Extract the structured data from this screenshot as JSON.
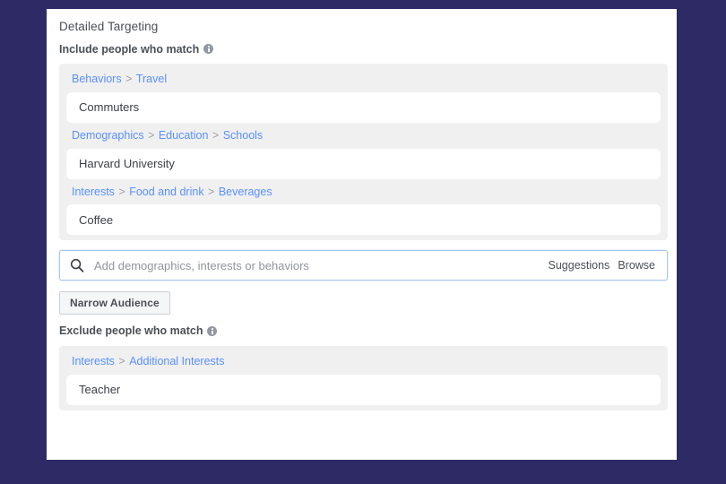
{
  "theme": {
    "background": "#2d2a66",
    "card": "#ffffff",
    "group_bg": "#f0f0f0",
    "link_blue": "#5890ff",
    "focus_border": "#a8c7f0",
    "text": "#4b4f56"
  },
  "panel": {
    "title": "Detailed Targeting",
    "include_label": "Include people who match",
    "exclude_label": "Exclude people who match",
    "info_icon": "info-icon"
  },
  "include_group": {
    "entries": [
      {
        "breadcrumb": [
          "Behaviors",
          "Travel"
        ],
        "item": "Commuters"
      },
      {
        "breadcrumb": [
          "Demographics",
          "Education",
          "Schools"
        ],
        "item": "Harvard University"
      },
      {
        "breadcrumb": [
          "Interests",
          "Food and drink",
          "Beverages"
        ],
        "item": "Coffee"
      }
    ]
  },
  "search": {
    "icon": "search-icon",
    "placeholder": "Add demographics, interests or behaviors",
    "value": "",
    "suggestions_label": "Suggestions",
    "browse_label": "Browse"
  },
  "narrow_button": {
    "label": "Narrow Audience"
  },
  "exclude_group": {
    "entries": [
      {
        "breadcrumb": [
          "Interests",
          "Additional Interests"
        ],
        "item": "Teacher"
      }
    ]
  }
}
